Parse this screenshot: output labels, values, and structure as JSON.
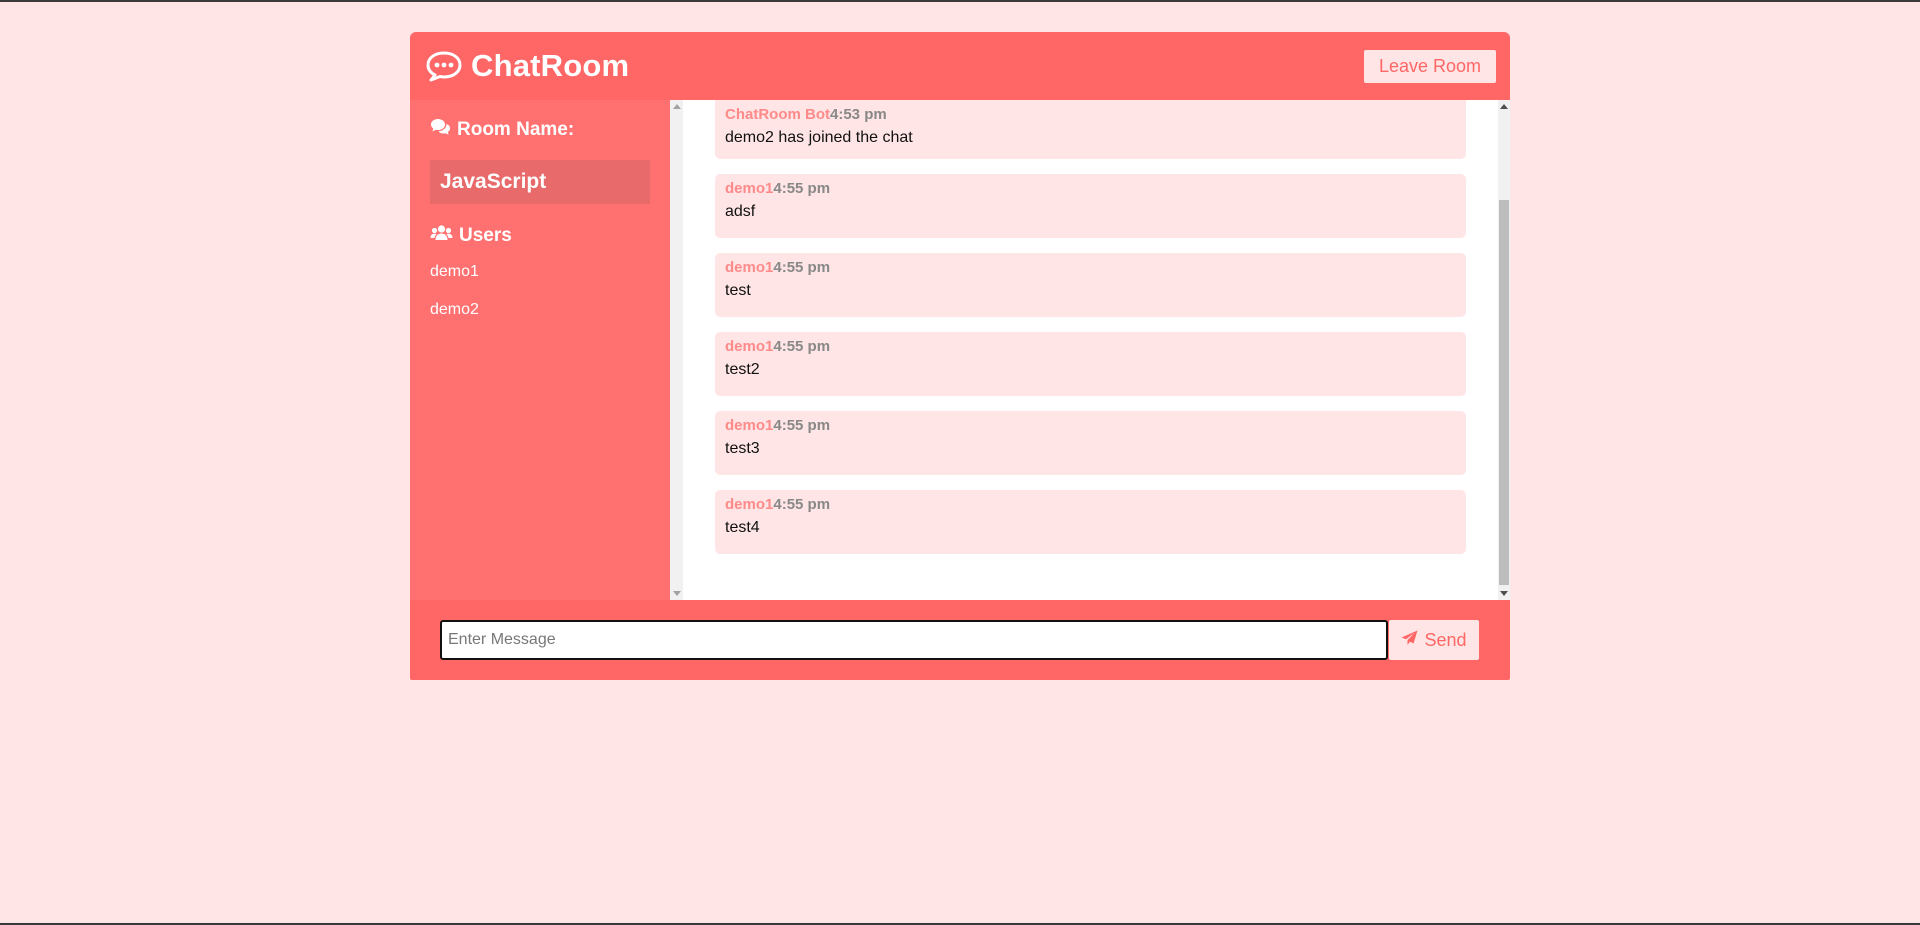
{
  "header": {
    "title": "ChatRoom",
    "leave_label": "Leave Room"
  },
  "sidebar": {
    "room_heading": "Room Name:",
    "room_name": "JavaScript",
    "users_heading": "Users",
    "users": [
      "demo1",
      "demo2"
    ]
  },
  "messages": [
    {
      "author": "ChatRoom Bot",
      "time": "4:53 pm",
      "text": "demo2 has joined the chat"
    },
    {
      "author": "demo1",
      "time": "4:55 pm",
      "text": "adsf"
    },
    {
      "author": "demo1",
      "time": "4:55 pm",
      "text": "test"
    },
    {
      "author": "demo1",
      "time": "4:55 pm",
      "text": "test2"
    },
    {
      "author": "demo1",
      "time": "4:55 pm",
      "text": "test3"
    },
    {
      "author": "demo1",
      "time": "4:55 pm",
      "text": "test4"
    }
  ],
  "composer": {
    "placeholder": "Enter Message",
    "value": "",
    "send_label": "Send"
  },
  "icons": {
    "brand": "chat-bubble-icon",
    "room": "comments-icon",
    "users": "users-icon",
    "send": "paper-plane-icon"
  },
  "colors": {
    "page_bg": "#ffe5e5",
    "primary": "#ff6666",
    "sidebar": "#ff7070",
    "message_bg": "#ffe5e5",
    "author": "#ff8a8a"
  }
}
